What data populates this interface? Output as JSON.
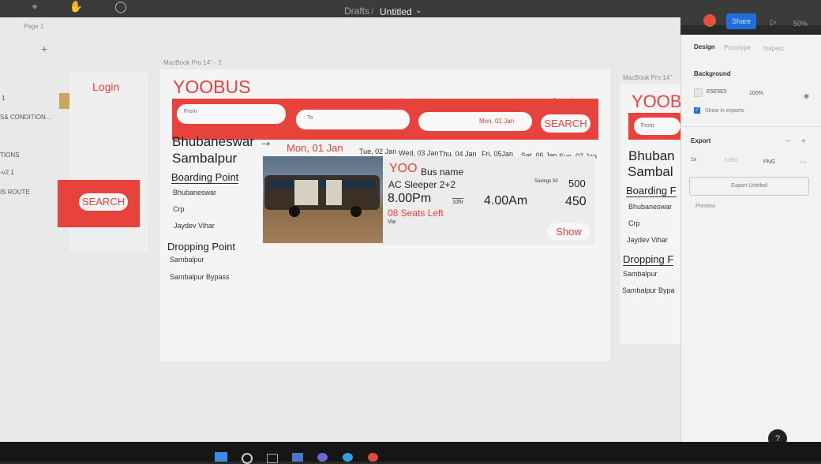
{
  "topbar": {
    "drafts": "Drafts",
    "sep": "/",
    "title": "Untitled",
    "share": "Share",
    "zoom": "50%"
  },
  "left_panel": {
    "page": "Page 1",
    "add": "+",
    "items": [
      "1",
      "S& CONDITION...",
      "TIONS",
      "-v2.1",
      "IS ROUTE"
    ]
  },
  "frame2": {
    "label": "MacBook Pro 14\" - 2",
    "logo": "YOOBUS",
    "login": "Login",
    "from_ph": "From",
    "to_ph": "To",
    "date_value": "Mon, 01 Jan",
    "search": "SEARCH",
    "route_from": "Bhubaneswar",
    "arrow": "→",
    "route_to": "Sambalpur",
    "selected_date": "Mon, 01 Jan",
    "dates": [
      "Tue, 02 Jan",
      "Wed, 03 Jan",
      "Thu, 04 Jan",
      "Fri, 05Jan",
      "Sat, 06 Jan",
      "Sun, 07 Jan"
    ],
    "boarding_title": "Boarding Point",
    "boarding": [
      "Bhubaneswar",
      "Crp",
      "Jaydev Vihar"
    ],
    "dropping_title": "Dropping Point",
    "dropping": [
      "Sambalpur",
      "Sambalpur Bypass"
    ],
    "bus": {
      "brand": "YOO",
      "name": "Bus name",
      "type": "AC Sleeper 2+2",
      "depart": "8.00Pm",
      "duration": "10hr",
      "arrive": "4.00Am",
      "seats": "08 Seats Left",
      "via": "Via",
      "savings": "Savings 50",
      "old_price": "500",
      "price": "450",
      "show": "Show"
    }
  },
  "frame_left": {
    "login": "Login",
    "search": "SEARCH"
  },
  "frame3": {
    "label": "MacBook Pro 14\"",
    "logo": "YOOB",
    "from_ph": "From",
    "route_from": "Bhuban",
    "route_to": "Sambal",
    "boarding_title": "Boarding F",
    "boarding": [
      "Bhubaneswar",
      "Crp",
      "Jaydev Vihar"
    ],
    "dropping_title": "Dropping F",
    "dropping": [
      "Sambalpur",
      "Sambalpur Bypa"
    ]
  },
  "right_panel": {
    "tabs": [
      "Design",
      "Prototype",
      "Inspect"
    ],
    "background_title": "Background",
    "bg_hex": "E5E5E5",
    "bg_opacity": "100%",
    "show_exports": "Show in exports",
    "export_title": "Export",
    "scale": "1x",
    "suffix": "Suffix",
    "format": "PNG",
    "export_button": "Export Untitled",
    "preview": "Preview"
  },
  "colors": {
    "accent": "#e8423c",
    "frame": "#f4f4f5",
    "canvas": "#e9e9ea",
    "share": "#1e6fd9"
  }
}
